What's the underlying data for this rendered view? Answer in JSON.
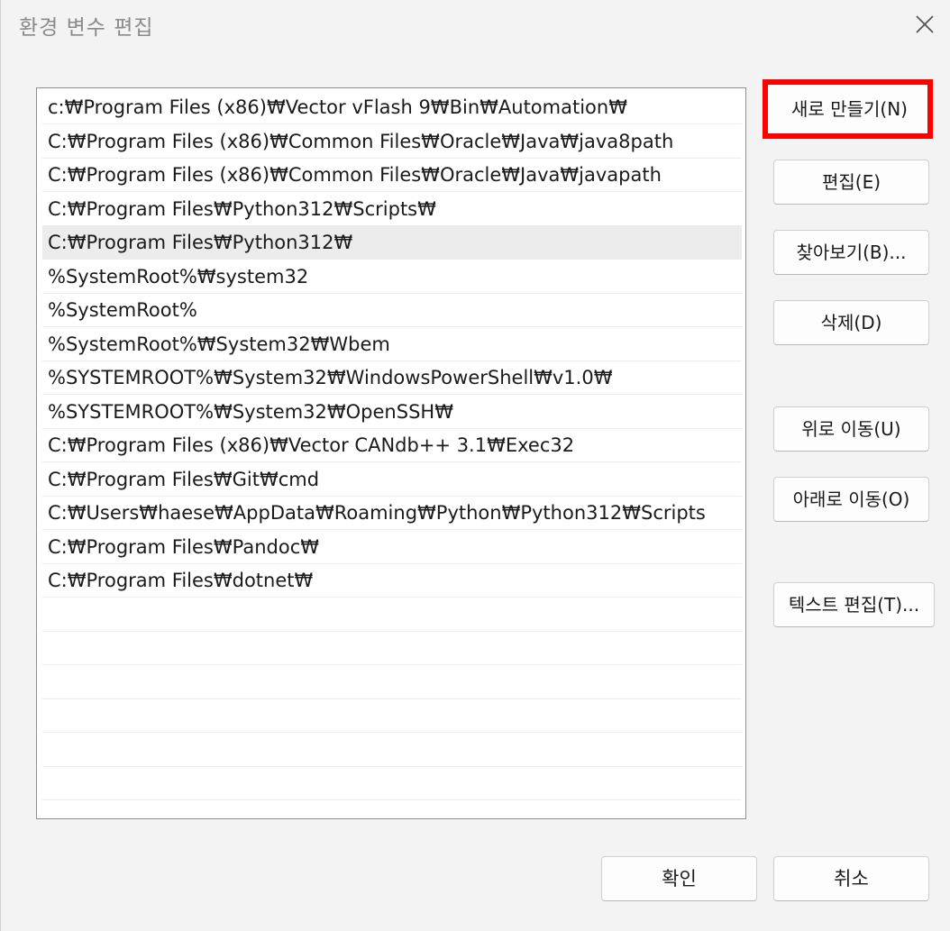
{
  "window": {
    "title": "환경 변수 편집"
  },
  "icons": {
    "close": "close-icon"
  },
  "accent": {
    "highlight_color": "#ff0000",
    "selected_row_color": "#ececec"
  },
  "paths": [
    "c:₩Program Files (x86)₩Vector vFlash 9₩Bin₩Automation₩",
    "C:₩Program Files (x86)₩Common Files₩Oracle₩Java₩java8path",
    "C:₩Program Files (x86)₩Common Files₩Oracle₩Java₩javapath",
    "C:₩Program Files₩Python312₩Scripts₩",
    "C:₩Program Files₩Python312₩",
    "%SystemRoot%₩system32",
    "%SystemRoot%",
    "%SystemRoot%₩System32₩Wbem",
    "%SYSTEMROOT%₩System32₩WindowsPowerShell₩v1.0₩",
    "%SYSTEMROOT%₩System32₩OpenSSH₩",
    "C:₩Program Files (x86)₩Vector CANdb++ 3.1₩Exec32",
    "C:₩Program Files₩Git₩cmd",
    "C:₩Users₩haese₩AppData₩Roaming₩Python₩Python312₩Scripts",
    "C:₩Program Files₩Pandoc₩",
    "C:₩Program Files₩dotnet₩"
  ],
  "selected_index": 4,
  "buttons": {
    "new": "새로 만들기(N)",
    "edit": "편집(E)",
    "browse": "찾아보기(B)...",
    "delete": "삭제(D)",
    "move_up": "위로 이동(U)",
    "move_down": "아래로 이동(O)",
    "edit_text": "텍스트 편집(T)..."
  },
  "footer": {
    "ok": "확인",
    "cancel": "취소"
  }
}
